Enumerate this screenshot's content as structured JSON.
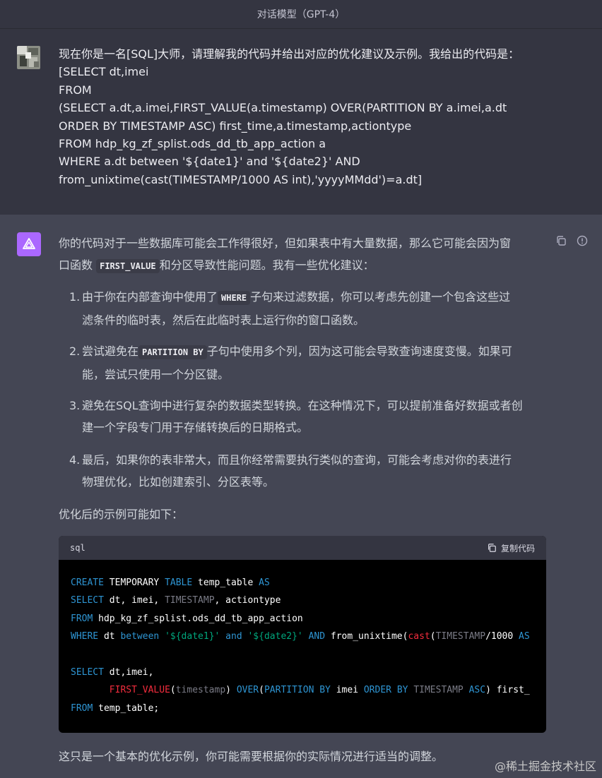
{
  "header": {
    "title": "对话模型（GPT-4）"
  },
  "user_message": {
    "lines": [
      "现在你是一名[SQL]大师，请理解我的代码并给出对应的优化建议及示例。我给出的代码是：",
      "[SELECT dt,imei",
      "FROM",
      "(SELECT a.dt,a.imei,FIRST_VALUE(a.timestamp) OVER(PARTITION BY a.imei,a.dt",
      "ORDER BY TIMESTAMP ASC) first_time,a.timestamp,actiontype",
      "FROM hdp_kg_zf_splist.ods_dd_tb_app_action a",
      "WHERE a.dt between '${date1}' and '${date2}' AND",
      "from_unixtime(cast(TIMESTAMP/1000 AS int),'yyyyMMdd')=a.dt]"
    ]
  },
  "assistant": {
    "intro": {
      "line1": "你的代码对于一些数据库可能会工作得很好，但如果表中有大量数据，那么它可能会因为窗",
      "line2_pre": "口函数 ",
      "line2_code": "FIRST_VALUE",
      "line2_post": "和分区导致性能问题。我有一些优化建议："
    },
    "items": [
      {
        "num": "1.",
        "pre": "由于你在内部查询中使用了",
        "code": "WHERE",
        "post": "子句来过滤数据，你可以考虑先创建一个包含这些过",
        "line2": "滤条件的临时表，然后在此临时表上运行你的窗口函数。"
      },
      {
        "num": "2.",
        "pre": "尝试避免在",
        "code": "PARTITION BY",
        "post": "子句中使用多个列，因为这可能会导致查询速度变慢。如果可",
        "line2": "能，尝试只使用一个分区键。"
      },
      {
        "num": "3.",
        "pre": "避免在SQL查询中进行复杂的数据类型转换。在这种情况下，可以提前准备好数据或者创",
        "code": "",
        "post": "",
        "line2": "建一个字段专门用于存储转换后的日期格式。"
      },
      {
        "num": "4.",
        "pre": "最后，如果你的表非常大，而且你经常需要执行类似的查询，可能会考虑对你的表进行",
        "code": "",
        "post": "",
        "line2": "物理优化，比如创建索引、分区表等。"
      }
    ],
    "example_heading": "优化后的示例可能如下：",
    "code_block": {
      "language": "sql",
      "copy_label": "复制代码",
      "lines": [
        [
          [
            "kw",
            "CREATE "
          ],
          [
            "txt",
            "TEMPORARY "
          ],
          [
            "kw",
            "TABLE "
          ],
          [
            "txt",
            "temp_table "
          ],
          [
            "kw",
            "AS"
          ]
        ],
        [
          [
            "kw",
            "SELECT "
          ],
          [
            "txt",
            "dt, imei, "
          ],
          [
            "dim",
            "TIMESTAMP"
          ],
          [
            "txt",
            ", actiontype"
          ]
        ],
        [
          [
            "kw",
            "FROM "
          ],
          [
            "txt",
            "hdp_kg_zf_splist.ods_dd_tb_app_action"
          ]
        ],
        [
          [
            "kw",
            "WHERE "
          ],
          [
            "txt",
            "dt "
          ],
          [
            "kw",
            "between "
          ],
          [
            "str",
            "'${date1}' "
          ],
          [
            "kw",
            "and "
          ],
          [
            "str",
            "'${date2}' "
          ],
          [
            "kw",
            "AND "
          ],
          [
            "txt",
            "from_unixtime("
          ],
          [
            "fn",
            "cast"
          ],
          [
            "txt",
            "("
          ],
          [
            "dim",
            "TIMESTAMP"
          ],
          [
            "txt",
            "/1000 "
          ],
          [
            "kw",
            "AS"
          ]
        ],
        [],
        [
          [
            "kw",
            "SELECT "
          ],
          [
            "txt",
            "dt,imei,"
          ]
        ],
        [
          [
            "txt",
            "       "
          ],
          [
            "fn",
            "FIRST_VALUE"
          ],
          [
            "txt",
            "("
          ],
          [
            "dim",
            "timestamp"
          ],
          [
            "txt",
            ") "
          ],
          [
            "kw",
            "OVER"
          ],
          [
            "txt",
            "("
          ],
          [
            "kw",
            "PARTITION BY "
          ],
          [
            "txt",
            "imei "
          ],
          [
            "kw",
            "ORDER BY "
          ],
          [
            "dim",
            "TIMESTAMP "
          ],
          [
            "kw",
            "ASC"
          ],
          [
            "txt",
            ") first_"
          ]
        ],
        [
          [
            "kw",
            "FROM "
          ],
          [
            "txt",
            "temp_table;"
          ]
        ]
      ]
    },
    "closing": "这只是一个基本的优化示例，你可能需要根据你的实际情况进行适当的调整。"
  },
  "watermark": "@稀土掘金技术社区",
  "colors": {
    "keyword": "#2e95d3",
    "function": "#f22c3d",
    "string": "#00a67d",
    "assistant_avatar": "#ab68ff"
  }
}
